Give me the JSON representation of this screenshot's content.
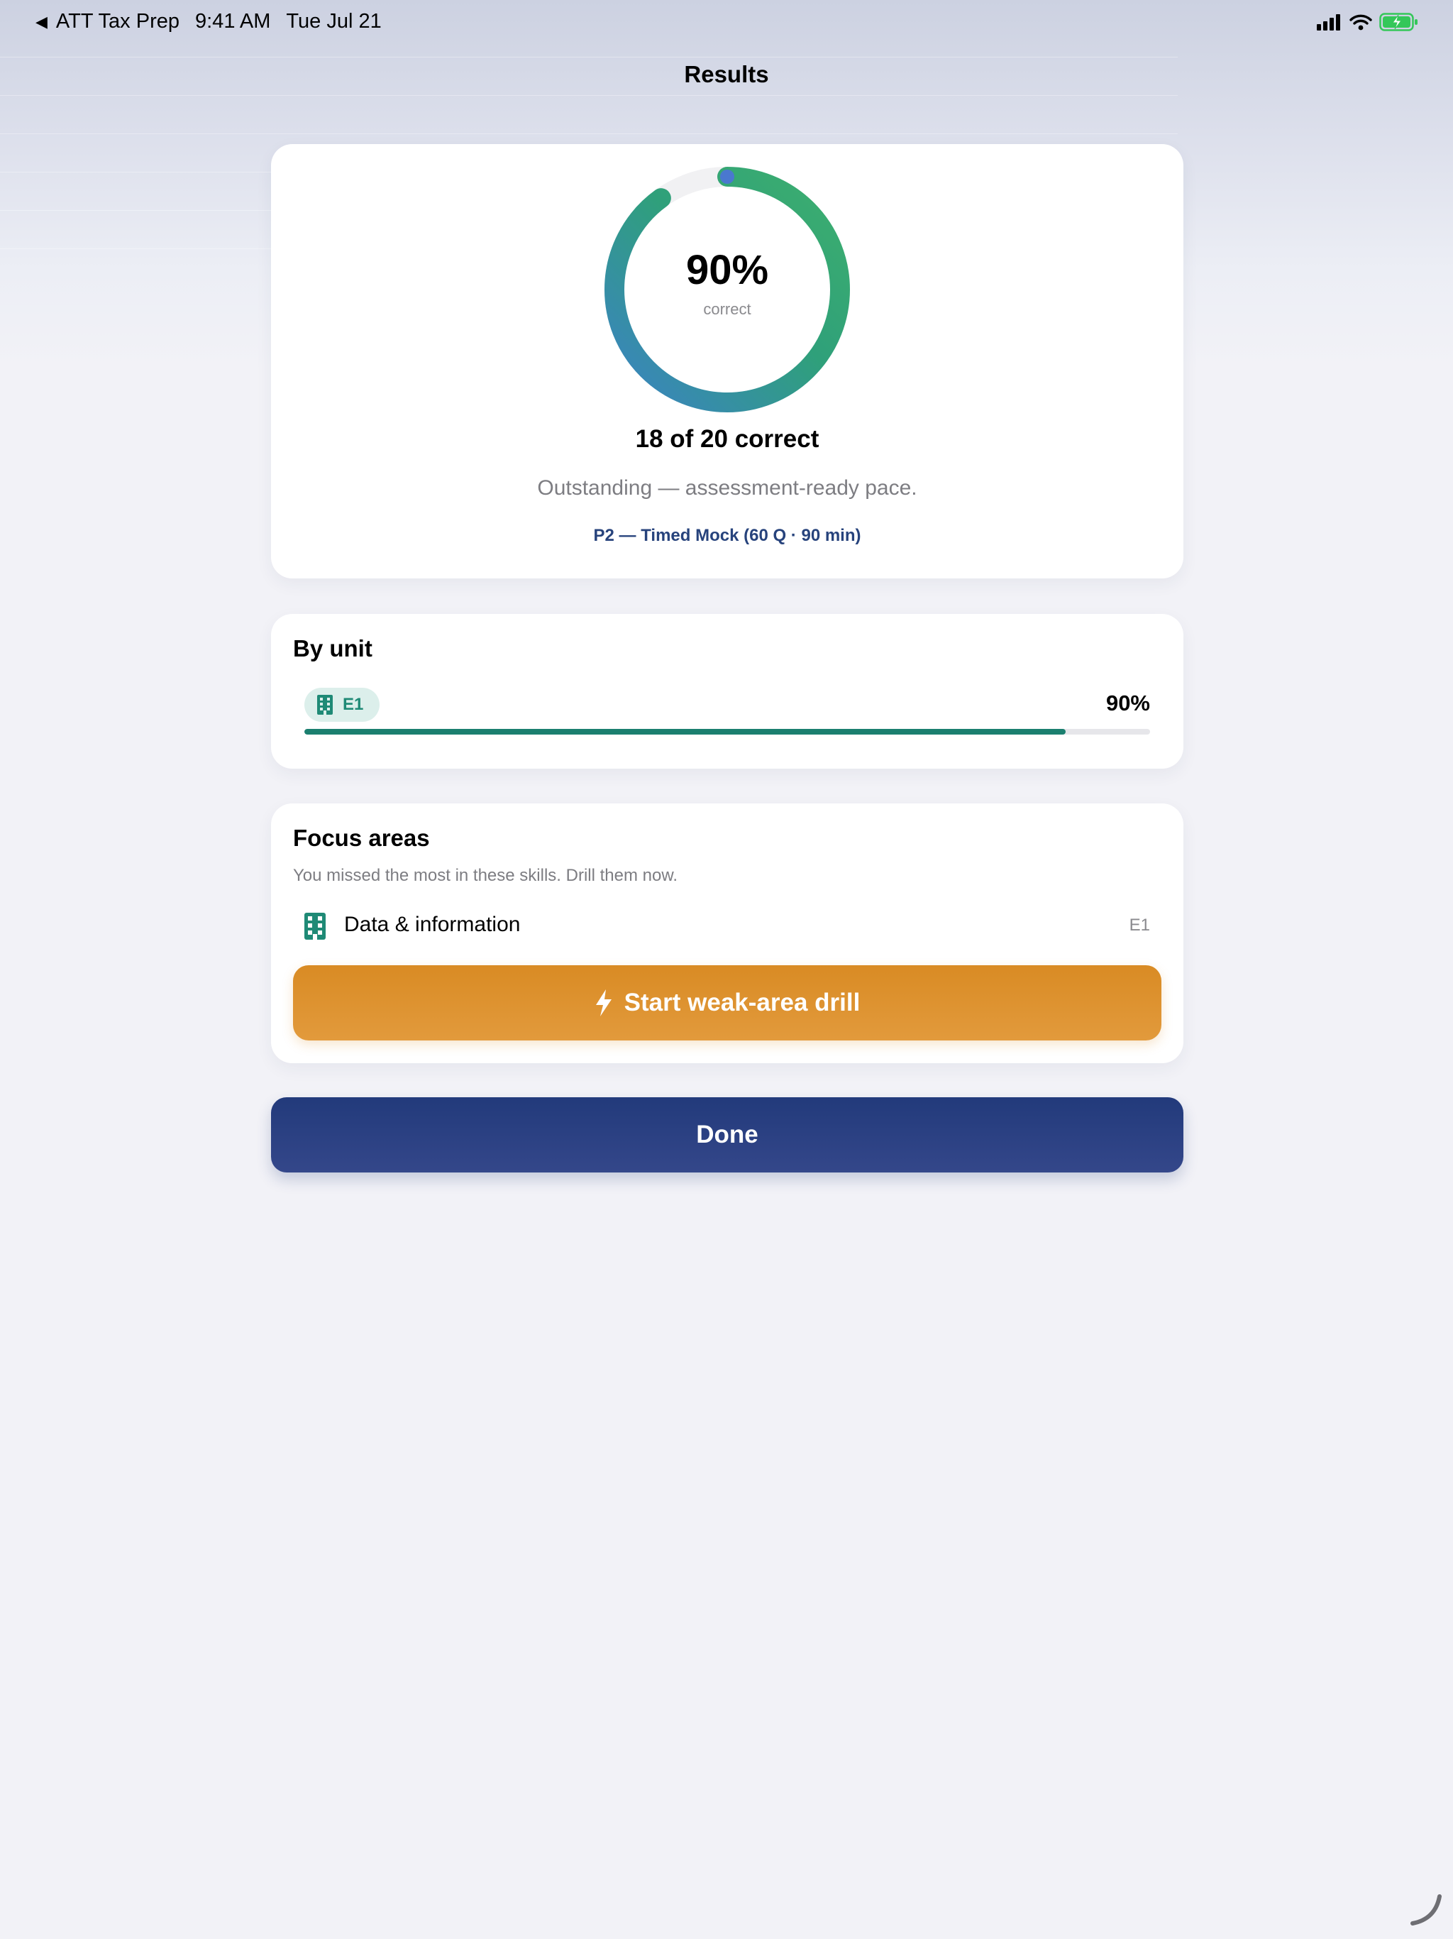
{
  "status_bar": {
    "back_app": "ATT Tax Prep",
    "time": "9:41 AM",
    "date": "Tue Jul 21",
    "battery_charging": true
  },
  "nav": {
    "title": "Results"
  },
  "score": {
    "percent_label": "90%",
    "percent_value": 0.9,
    "percent_caption": "correct",
    "summary": "18 of 20 correct",
    "verdict": "Outstanding — assessment-ready pace.",
    "exam": "P2 — Timed Mock (60 Q · 90 min)"
  },
  "by_unit": {
    "heading": "By unit",
    "units": [
      {
        "code": "E1",
        "icon": "building-icon",
        "percent_label": "90%",
        "fraction": 0.9
      }
    ]
  },
  "focus": {
    "heading": "Focus areas",
    "subtitle": "You missed the most in these skills. Drill them now.",
    "items": [
      {
        "icon": "building-icon",
        "name": "Data & information",
        "unit": "E1"
      }
    ],
    "drill_button": {
      "icon": "bolt-icon",
      "label": "Start weak-area drill"
    }
  },
  "done_button": {
    "label": "Done"
  },
  "colors": {
    "ring_start": "#3b82c4",
    "ring_end": "#2ea26a",
    "teal": "#1b7f6f",
    "orange": "#df922f",
    "navy": "#263e7e",
    "exam_text": "#27437c"
  }
}
